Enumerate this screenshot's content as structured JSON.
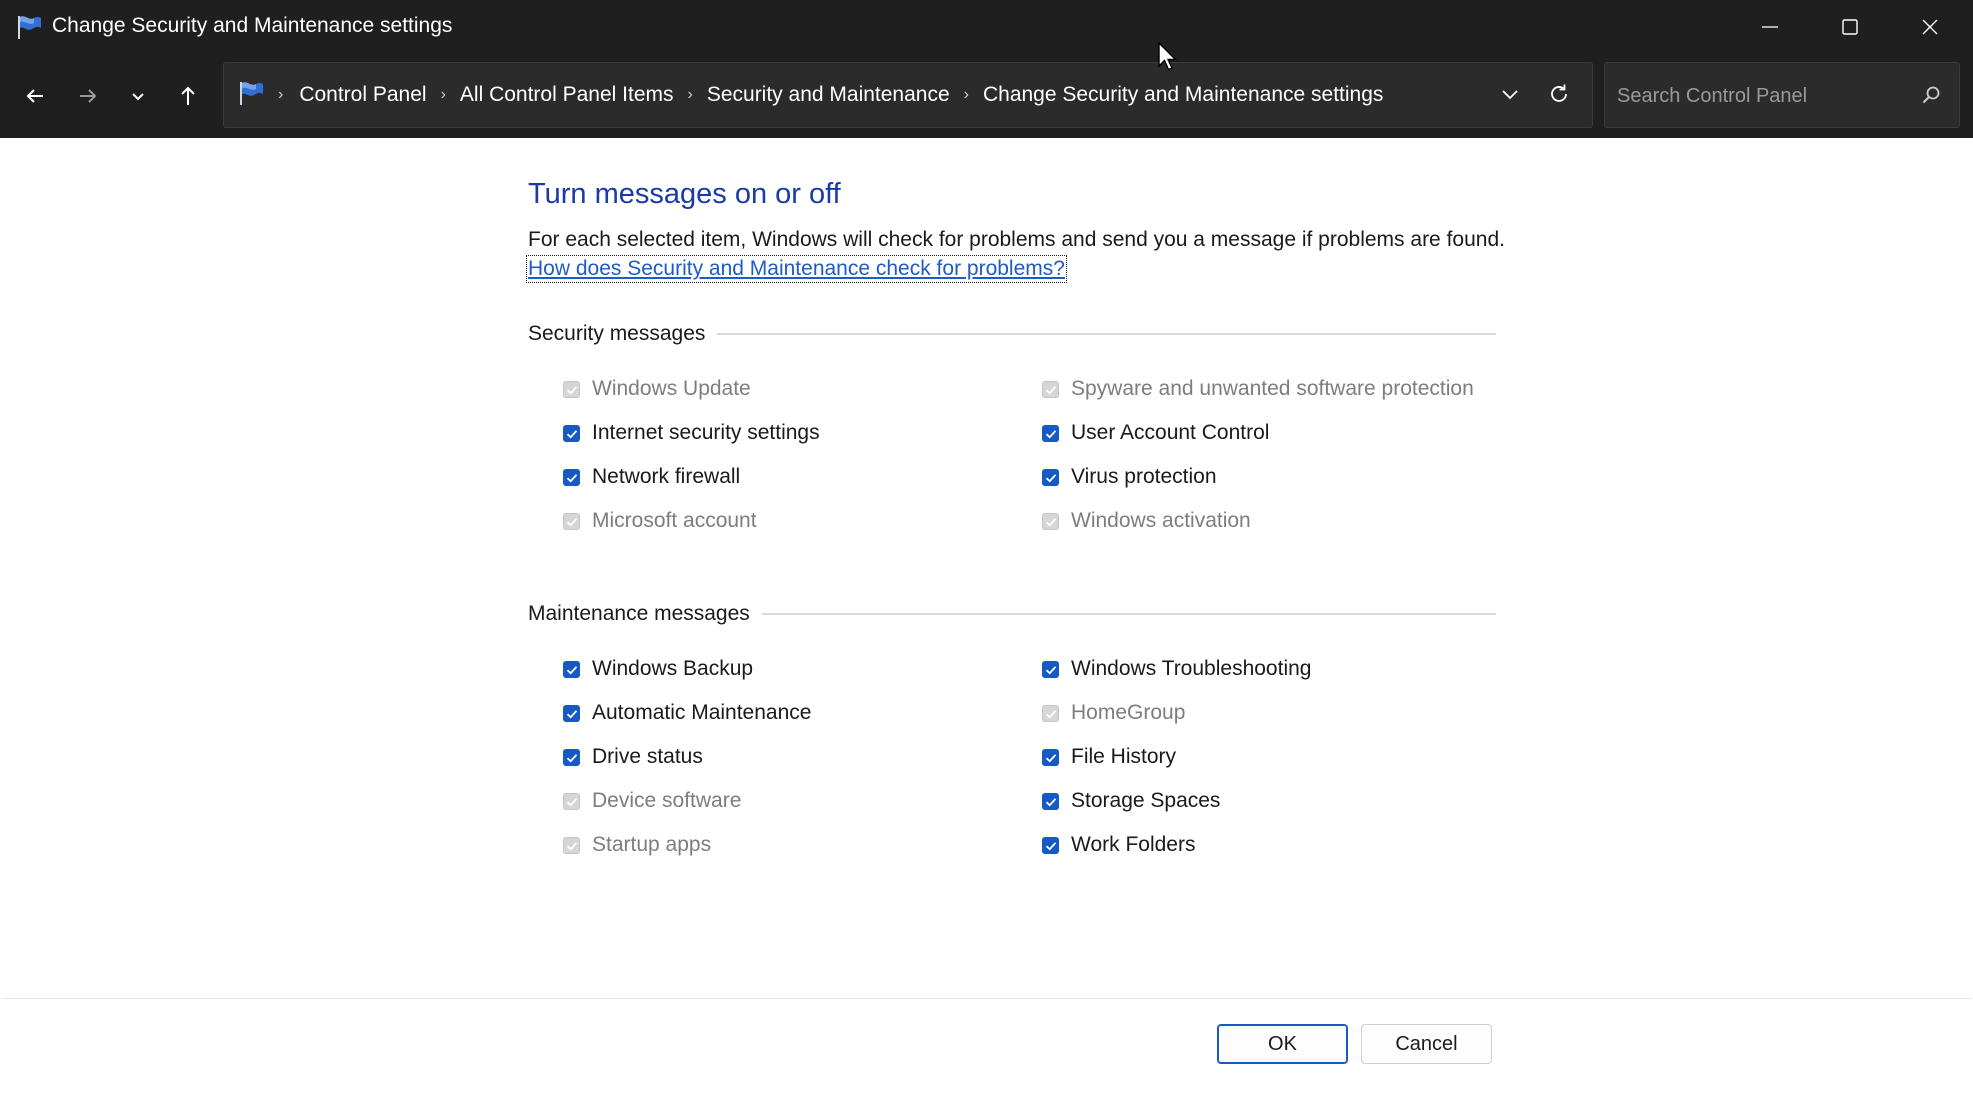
{
  "window": {
    "title": "Change Security and Maintenance settings",
    "minimize_icon": "minimize-icon",
    "maximize_icon": "maximize-icon",
    "close_icon": "close-icon"
  },
  "navigation": {
    "back_icon": "arrow-left-icon",
    "forward_icon": "arrow-right-icon",
    "recent_icon": "chevron-down-icon",
    "up_icon": "arrow-up-icon",
    "breadcrumbs": [
      "Control Panel",
      "All Control Panel Items",
      "Security and Maintenance",
      "Change Security and Maintenance settings"
    ],
    "refresh_icon": "refresh-icon"
  },
  "search": {
    "placeholder": "Search Control Panel",
    "value": ""
  },
  "main": {
    "heading": "Turn messages on or off",
    "description": "For each selected item, Windows will check for problems and send you a message if problems are found.",
    "help_link": "How does Security and Maintenance check for problems?",
    "security": {
      "title": "Security messages",
      "items": [
        {
          "label": "Windows Update",
          "checked": true,
          "enabled": false
        },
        {
          "label": "Spyware and unwanted software protection",
          "checked": true,
          "enabled": false
        },
        {
          "label": "Internet security settings",
          "checked": true,
          "enabled": true
        },
        {
          "label": "User Account Control",
          "checked": true,
          "enabled": true
        },
        {
          "label": "Network firewall",
          "checked": true,
          "enabled": true
        },
        {
          "label": "Virus protection",
          "checked": true,
          "enabled": true
        },
        {
          "label": "Microsoft account",
          "checked": true,
          "enabled": false
        },
        {
          "label": "Windows activation",
          "checked": true,
          "enabled": false
        }
      ]
    },
    "maintenance": {
      "title": "Maintenance messages",
      "items": [
        {
          "label": "Windows Backup",
          "checked": true,
          "enabled": true
        },
        {
          "label": "Windows Troubleshooting",
          "checked": true,
          "enabled": true
        },
        {
          "label": "Automatic Maintenance",
          "checked": true,
          "enabled": true
        },
        {
          "label": "HomeGroup",
          "checked": true,
          "enabled": false
        },
        {
          "label": "Drive status",
          "checked": true,
          "enabled": true
        },
        {
          "label": "File History",
          "checked": true,
          "enabled": true
        },
        {
          "label": "Device software",
          "checked": true,
          "enabled": false
        },
        {
          "label": "Storage Spaces",
          "checked": true,
          "enabled": true
        },
        {
          "label": "Startup apps",
          "checked": true,
          "enabled": false
        },
        {
          "label": "Work Folders",
          "checked": true,
          "enabled": true
        }
      ]
    }
  },
  "footer": {
    "ok_label": "OK",
    "cancel_label": "Cancel"
  },
  "colors": {
    "accent": "#1759c5",
    "heading": "#1a3aa6",
    "link": "#1f5bc7",
    "titlebar": "#1f1f1f"
  }
}
